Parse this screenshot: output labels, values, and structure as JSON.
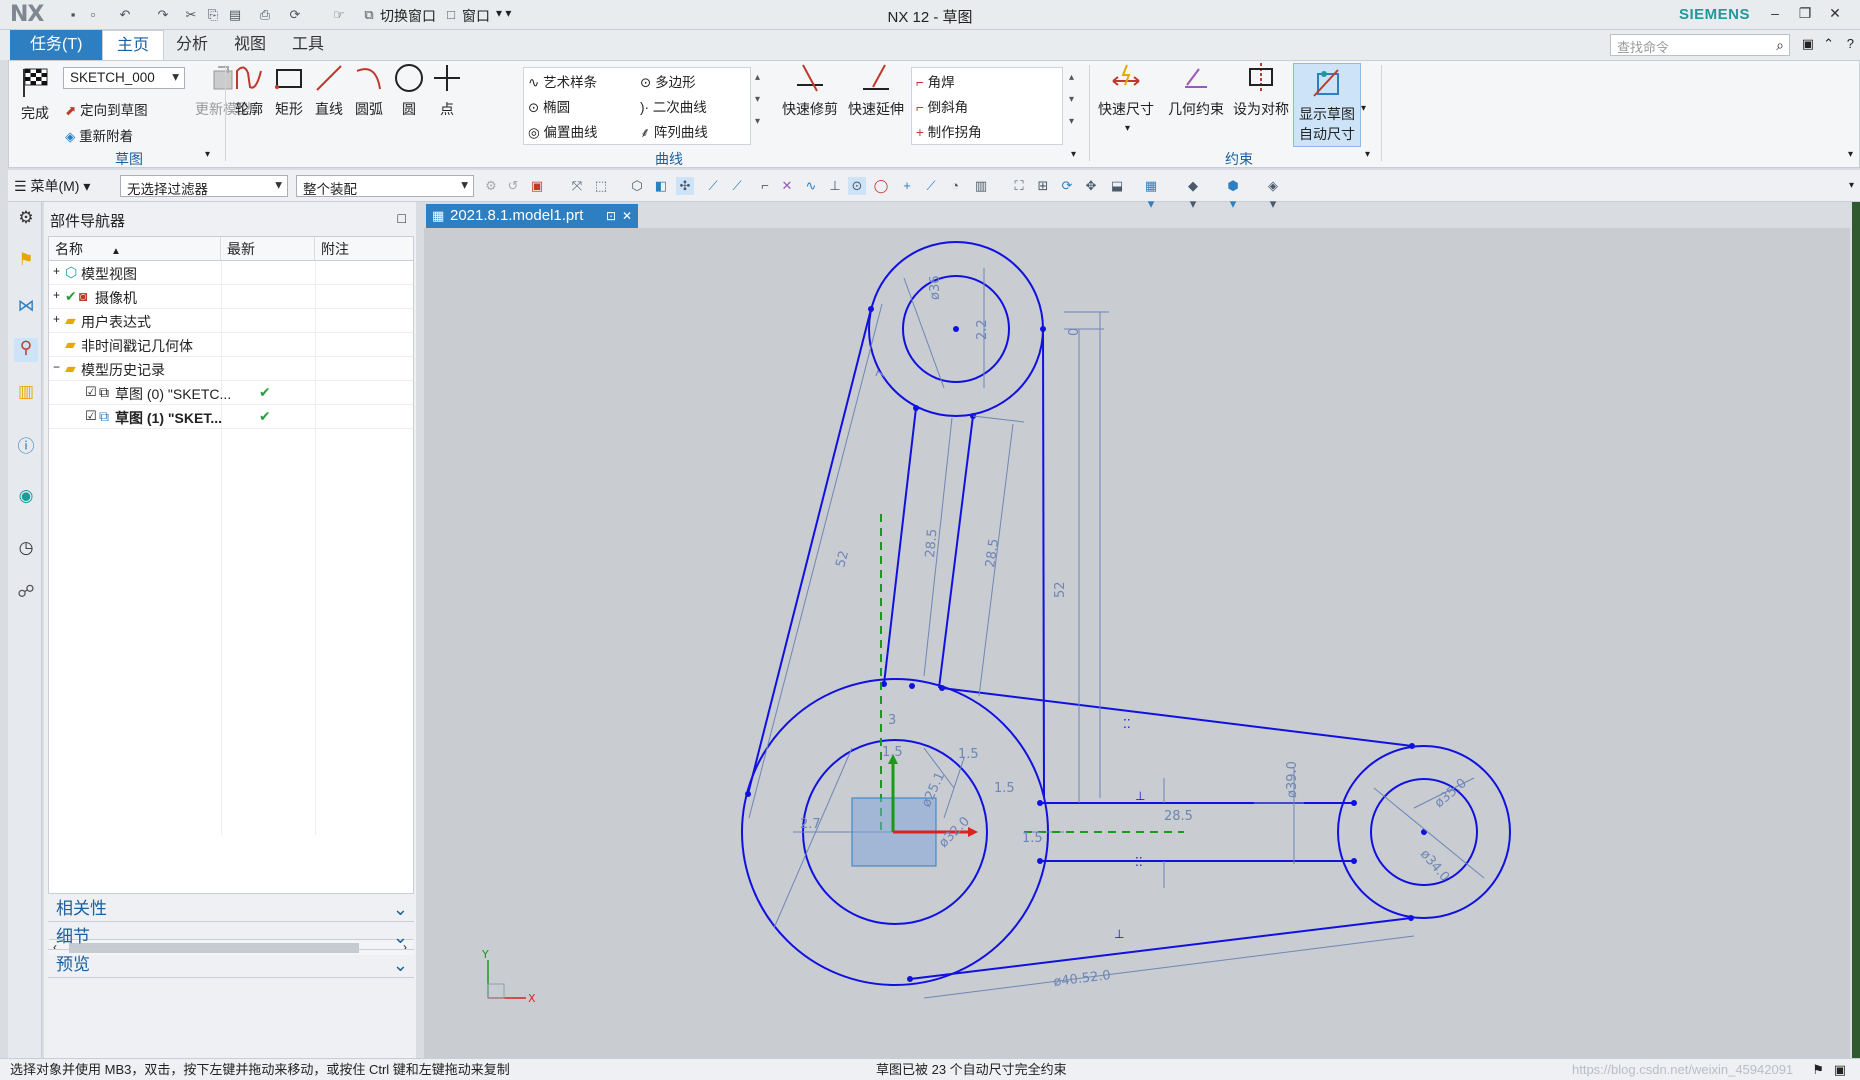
{
  "app": {
    "logo": "NX",
    "title": "NX 12 - 草图",
    "brand": "SIEMENS",
    "search_placeholder": "查找命令"
  },
  "quick_access": {
    "switch_window": "切换窗口",
    "window": "窗口"
  },
  "tabs": [
    "任务(T)",
    "主页",
    "分析",
    "视图",
    "工具"
  ],
  "ribbon": {
    "sketch_group": {
      "finish": "完成",
      "sketch_name": "SKETCH_000",
      "orient": "定向到草图",
      "reattach": "重新附着",
      "update_model": "更新模型",
      "label": "草图"
    },
    "curve_group": {
      "profile": "轮廓",
      "rectangle": "矩形",
      "line": "直线",
      "arc": "圆弧",
      "circle": "圆",
      "point": "点",
      "studio_spline": "艺术样条",
      "polygon": "多边形",
      "ellipse": "椭圆",
      "conic": "二次曲线",
      "offset_curve": "偏置曲线",
      "pattern_curve": "阵列曲线",
      "quick_trim": "快速修剪",
      "quick_extend": "快速延伸",
      "fillet": "角焊",
      "chamfer": "倒斜角",
      "make_corner": "制作拐角",
      "label": "曲线"
    },
    "constraint_group": {
      "rapid_dimension": "快速尺寸",
      "geometric_constraints": "几何约束",
      "make_symmetric": "设为对称",
      "show_auto_dim_line1": "显示草图",
      "show_auto_dim_line2": "自动尺寸",
      "label": "约束"
    }
  },
  "toolbar2": {
    "menu": "菜单(M)",
    "filter": "无选择过滤器",
    "assembly": "整个装配"
  },
  "navigator": {
    "title": "部件导航器",
    "columns": [
      "名称",
      "最新",
      "附注"
    ],
    "rows": [
      {
        "label": "模型视图",
        "expander": "+"
      },
      {
        "label": "摄像机",
        "expander": "+"
      },
      {
        "label": "用户表达式",
        "expander": "+"
      },
      {
        "label": "非时间戳记几何体",
        "expander": ""
      },
      {
        "label": "模型历史记录",
        "expander": "−"
      },
      {
        "label": "草图 (0) \"SKETC...",
        "expander": ""
      },
      {
        "label": "草图 (1) \"SKET...",
        "expander": ""
      }
    ],
    "accordions": [
      "相关性",
      "细节",
      "预览"
    ]
  },
  "document_tab": "2021.8.1.model1.prt",
  "dimensions": [
    "ø36",
    "2.2",
    "0",
    "7",
    "52",
    "28.5",
    "28.5",
    "52",
    "3",
    "1.5",
    "1.5",
    "ø25.1",
    "ø32.0",
    "1.5",
    "2.7",
    "28.5",
    "ø39.0",
    "ø35.0",
    "ø34.0",
    "1.5",
    "ø40.52.0"
  ],
  "axis": {
    "x": "X",
    "y": "Y"
  },
  "status": {
    "left": "选择对象并使用 MB3，双击，按下左键并拖动来移动，或按住 Ctrl 键和左键拖动来复制",
    "center": "草图已被 23 个自动尺寸完全约束",
    "watermark": "https://blog.csdn.net/weixin_45942091"
  },
  "colors": {
    "accent": "#2d7fc1",
    "sketch": "#1010e0",
    "dim": "#6e86b6",
    "canvas": "#c9ccd1"
  }
}
